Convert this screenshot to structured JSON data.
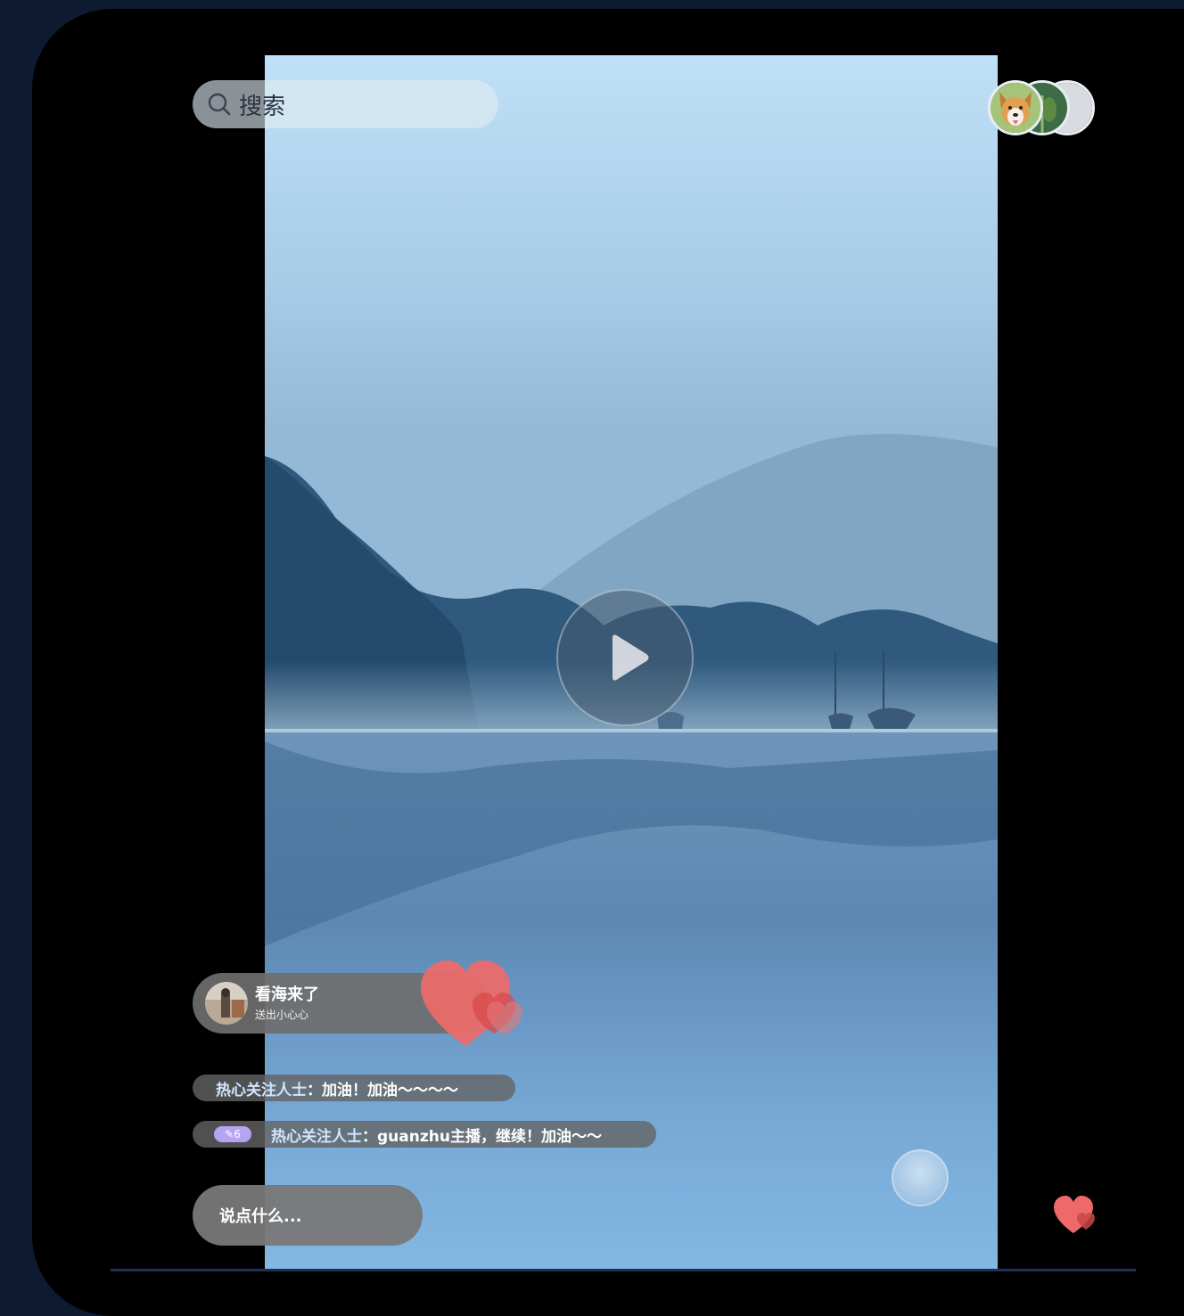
{
  "search": {
    "placeholder": "搜索"
  },
  "viewers": {
    "avatars": [
      "dog-avatar",
      "plant-avatar",
      "blank-avatar"
    ]
  },
  "gift_notice": {
    "user": "看海来了",
    "action": "送出小心心"
  },
  "comments": [
    {
      "user": "热心关注人士",
      "separator": "：",
      "text": "加油！加油～～～～"
    },
    {
      "badge": "✎6",
      "user": "热心关注人士",
      "separator": "：",
      "text": "guanzhu主播，继续！加油～～"
    }
  ],
  "input": {
    "placeholder": "说点什么..."
  },
  "colors": {
    "heart": "#ef6b6b",
    "page_bg": "#0d1a30",
    "badge": "#b6a4f2",
    "comment_user": "#cfe6ff"
  }
}
